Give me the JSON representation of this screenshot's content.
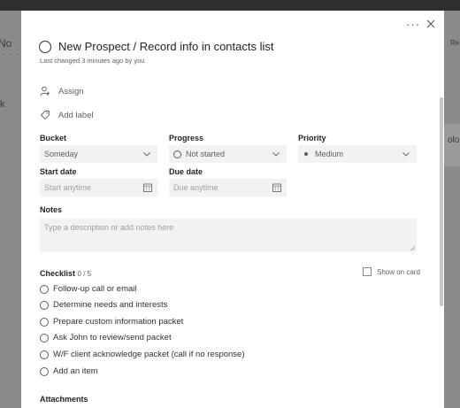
{
  "background": {
    "left_fragment": "No",
    "left_dots": "· · ·",
    "left_k": "k",
    "right_fragment_top": "Re",
    "right_fragment_mid": "olo"
  },
  "task": {
    "title": "New Prospect / Record info in contacts list",
    "last_changed": "Last changed 3 minutes ago by you",
    "more_label": "···"
  },
  "actions": {
    "assign": "Assign",
    "add_label": "Add label"
  },
  "fields": {
    "bucket": {
      "label": "Bucket",
      "value": "Someday"
    },
    "progress": {
      "label": "Progress",
      "value": "Not started"
    },
    "priority": {
      "label": "Priority",
      "value": "Medium"
    },
    "start_date": {
      "label": "Start date",
      "placeholder": "Start anytime"
    },
    "due_date": {
      "label": "Due date",
      "placeholder": "Due anytime"
    }
  },
  "notes": {
    "label": "Notes",
    "placeholder": "Type a description or add notes here"
  },
  "checklist": {
    "label": "Checklist",
    "count": "0 / 5",
    "show_on_card": "Show on card",
    "items": [
      "Follow-up call or email",
      "Determine needs and interests",
      "Prepare custom information packet",
      "Ask John to review/send packet",
      "W/F client acknowledge packet (call if no response)"
    ],
    "add_item": "Add an item"
  },
  "attachments": {
    "label": "Attachments"
  },
  "colors": {
    "field_bg": "#f3f2f1",
    "text_primary": "#252423",
    "text_secondary": "#605e5c",
    "overlay": "#7a7a7a"
  }
}
